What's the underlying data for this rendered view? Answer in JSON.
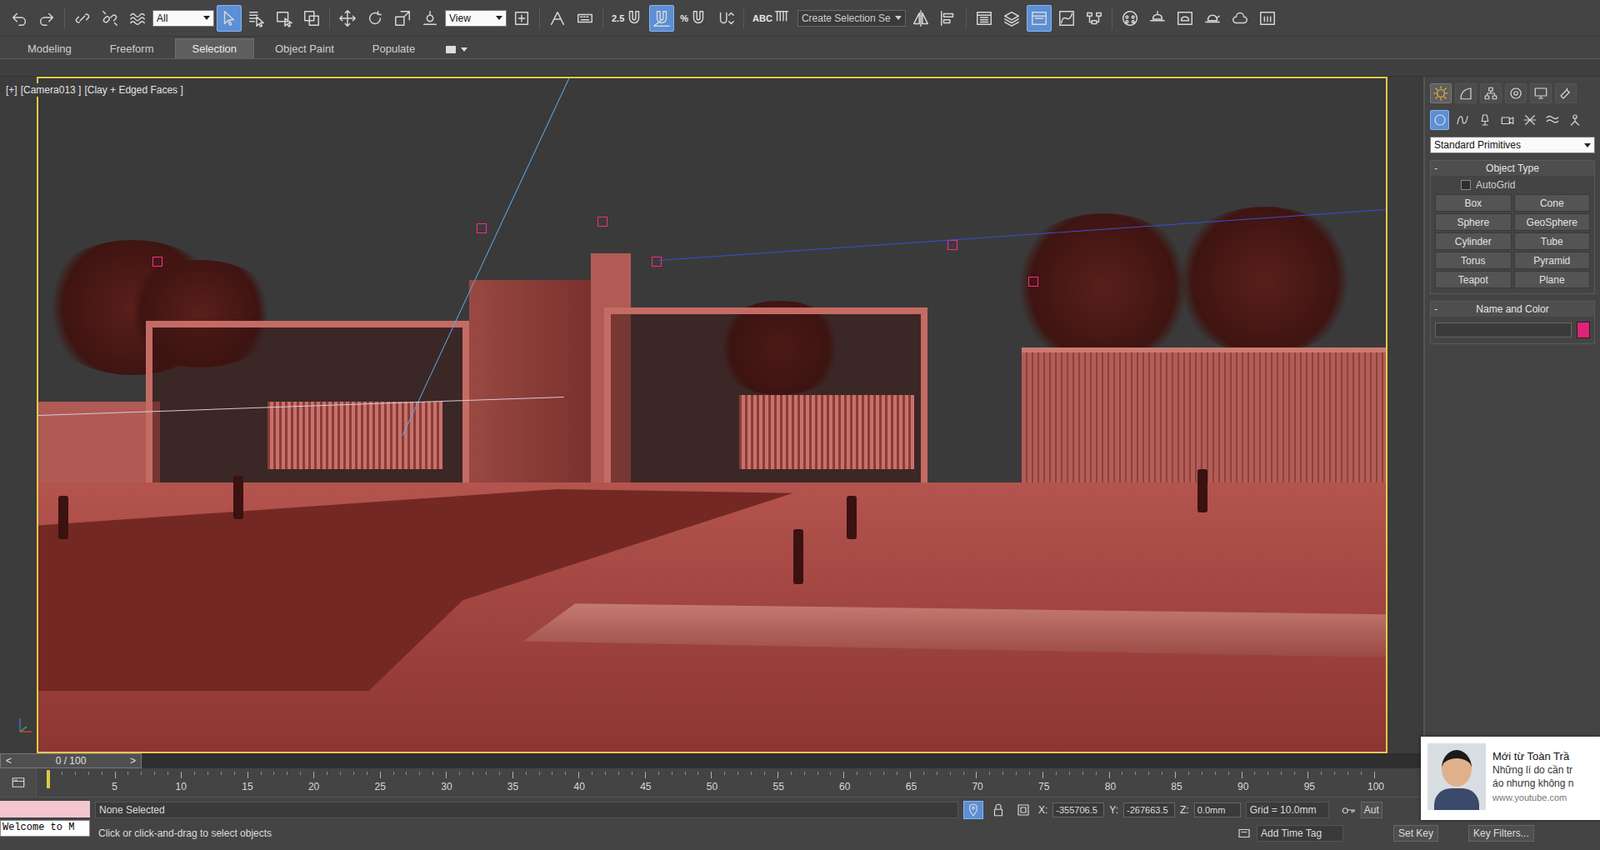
{
  "toolbar": {
    "selection_filter": "All",
    "select_object": {
      "active": true
    },
    "reference_coordinate": "View",
    "snap_toggle": {
      "label": "2.5",
      "active": false
    },
    "angle_snap": {
      "active": true
    },
    "percent_snap": {
      "label": "%",
      "active": false
    },
    "edit_named_selection": {
      "label": "ABC"
    },
    "named_selection": "Create Selection Se",
    "toggle_ribbon": {
      "active": true
    }
  },
  "ribbon_tabs": [
    {
      "label": "Modeling",
      "selected": false
    },
    {
      "label": "Freeform",
      "selected": false
    },
    {
      "label": "Selection",
      "selected": true
    },
    {
      "label": "Object Paint",
      "selected": false
    },
    {
      "label": "Populate",
      "selected": false
    }
  ],
  "viewport": {
    "labels": [
      "[+]",
      "[Camera013 ]",
      "[Clay + Edged Faces ]"
    ],
    "active": true
  },
  "command_panel": {
    "tabs": [
      {
        "selected": true
      },
      {
        "selected": false
      },
      {
        "selected": false
      },
      {
        "selected": false
      },
      {
        "selected": false
      },
      {
        "selected": false
      }
    ],
    "categories": [
      {
        "selected": true
      },
      {
        "selected": false
      },
      {
        "selected": false
      },
      {
        "selected": false
      },
      {
        "selected": false
      },
      {
        "selected": false
      },
      {
        "selected": false
      }
    ],
    "subcategory": "Standard Primitives",
    "object_type": {
      "toggle": "-",
      "title": "Object Type",
      "autogrid": {
        "label": "AutoGrid",
        "checked": false
      },
      "buttons": [
        "Box",
        "Cone",
        "Sphere",
        "GeoSphere",
        "Cylinder",
        "Tube",
        "Torus",
        "Pyramid",
        "Teapot",
        "Plane"
      ]
    },
    "name_and_color": {
      "toggle": "-",
      "title": "Name and Color",
      "name": "",
      "color": "#e0217a"
    }
  },
  "time_slider": {
    "prev": "<",
    "label": "0 / 100",
    "next": ">",
    "level": 0
  },
  "track_bar": {
    "ticks": [
      "5",
      "10",
      "15",
      "20",
      "25",
      "30",
      "35",
      "40",
      "45",
      "50",
      "55",
      "60",
      "65",
      "70",
      "75",
      "80",
      "85",
      "90",
      "95",
      "100"
    ]
  },
  "status_bar": {
    "listener": "Welcome to M",
    "selection": "None Selected",
    "prompt": "Click or click-and-drag to select objects",
    "isolate_selection": {
      "active": true
    },
    "x": {
      "label": "X:",
      "value": "-355706.5"
    },
    "y": {
      "label": "Y:",
      "value": "-267663.5"
    },
    "z": {
      "label": "Z:",
      "value": "0.0mm"
    },
    "grid": "Grid = 10.0mm",
    "add_time_tag": "Add Time Tag",
    "auto_key": "Aut",
    "set_key": "Set Key",
    "key_filters": "Key Filters..."
  },
  "notification": {
    "title": "Mới từ Toàn Trầ",
    "lines": [
      "Những lí do cần tr",
      "áo nhưng không n"
    ],
    "source": "www.youtube.com"
  }
}
